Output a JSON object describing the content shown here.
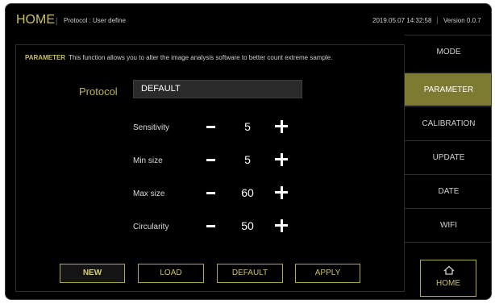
{
  "header": {
    "title": "HOME",
    "separator": "|",
    "breadcrumb": "Protocol : User define",
    "datetime": "2019.05.07 14:32:58",
    "version": "Version 0.0.7"
  },
  "description": {
    "label": "PARAMETER",
    "text": "This function allows you to alter the image analysis software to better count extreme sample."
  },
  "protocol": {
    "label": "Protocol",
    "value": "DEFAULT"
  },
  "params": [
    {
      "label": "Sensitivity",
      "value": "5"
    },
    {
      "label": "Min size",
      "value": "5"
    },
    {
      "label": "Max size",
      "value": "60"
    },
    {
      "label": "Circularity",
      "value": "50"
    }
  ],
  "actions": {
    "new": "NEW",
    "load": "LOAD",
    "default": "DEFAULT",
    "apply": "APPLY"
  },
  "sidebar": {
    "items": [
      {
        "label": "MODE"
      },
      {
        "label": "PARAMETER"
      },
      {
        "label": "CALIBRATION"
      },
      {
        "label": "UPDATE"
      },
      {
        "label": "DATE"
      },
      {
        "label": "WIFI"
      }
    ],
    "home_label": "HOME"
  },
  "colors": {
    "accent": "#c9c063",
    "active_tab": "#7d7a32",
    "background": "#000000"
  },
  "icons": {
    "home": "home-icon"
  }
}
